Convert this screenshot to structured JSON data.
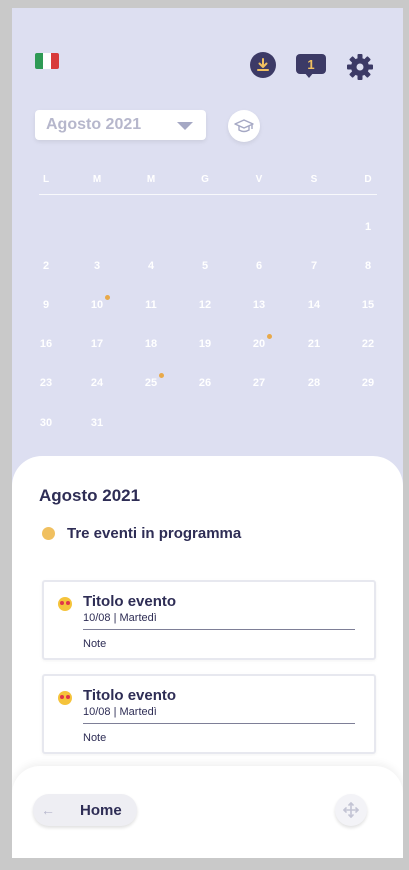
{
  "colors": {
    "background": "#dddff1",
    "dark_navy": "#3c3a66",
    "accent_yellow": "#f0c060",
    "event_dot": "#e8a94a",
    "flag_green": "#2e9a55",
    "flag_white": "#ffffff",
    "flag_red": "#d83a3a"
  },
  "header": {
    "language_flag": "italy-flag-icon",
    "icons": [
      "download-icon",
      "chat-bubble-icon",
      "gear-icon"
    ],
    "messages_count": "1"
  },
  "month_select": {
    "value": "Agosto 2021",
    "icon": "chevron-down-icon"
  },
  "graduation_icon": "graduation-cap-icon",
  "calendar": {
    "weekdays": [
      "L",
      "M",
      "M",
      "G",
      "V",
      "S",
      "D"
    ],
    "days": [
      "1",
      "2",
      "3",
      "4",
      "5",
      "6",
      "7",
      "8",
      "9",
      "10",
      "11",
      "12",
      "13",
      "14",
      "15",
      "16",
      "17",
      "18",
      "19",
      "20",
      "21",
      "22",
      "23",
      "24",
      "25",
      "26",
      "27",
      "28",
      "29",
      "30",
      "31"
    ],
    "event_days": [
      "10",
      "20",
      "25"
    ]
  },
  "sheet": {
    "title": "Agosto 2021",
    "summary": "Tre eventi in programma",
    "events": [
      {
        "title": "Titolo evento",
        "date": "10/08 | Martedì",
        "note": "Note",
        "icon": "heart-eyes-emoji-icon"
      },
      {
        "title": "Titolo evento",
        "date": "10/08 | Martedì",
        "note": "Note",
        "icon": "heart-eyes-emoji-icon"
      }
    ]
  },
  "footer": {
    "home_label": "Home",
    "back_icon": "arrow-left-icon",
    "fab_icon": "move-arrows-icon"
  }
}
